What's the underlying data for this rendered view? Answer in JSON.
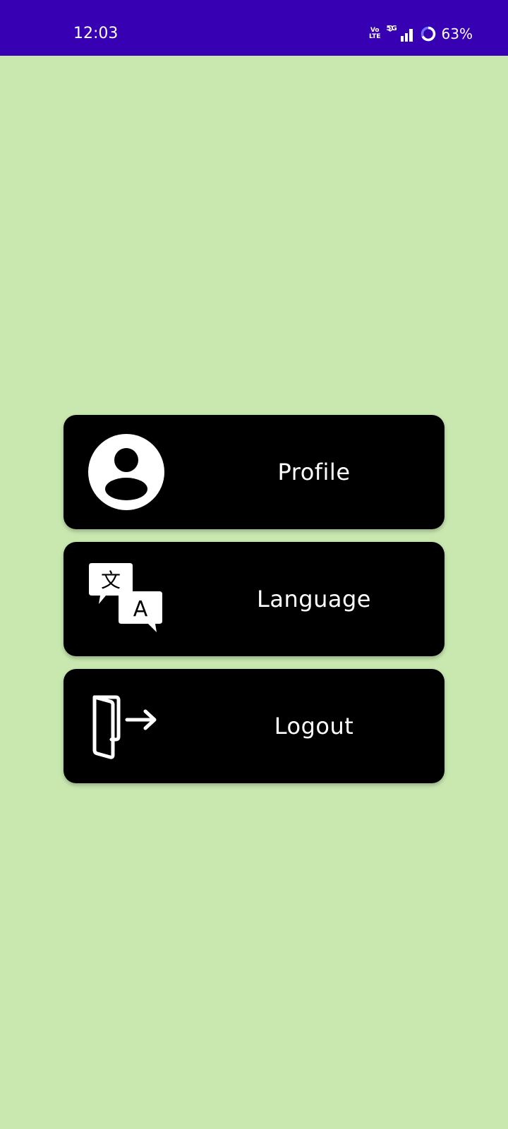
{
  "status_bar": {
    "time": "12:03",
    "volte_top": "Vo",
    "volte_bottom": "LTE",
    "network": "5G",
    "battery": "63%",
    "background": "#3700b3"
  },
  "menu": {
    "background": "#c8e8b0",
    "items": [
      {
        "label": "Profile",
        "icon": "account-circle-icon"
      },
      {
        "label": "Language",
        "icon": "translate-icon"
      },
      {
        "label": "Logout",
        "icon": "logout-door-icon"
      }
    ]
  },
  "icons": {
    "translate_glyph_top": "文",
    "translate_glyph_bottom": "A"
  }
}
